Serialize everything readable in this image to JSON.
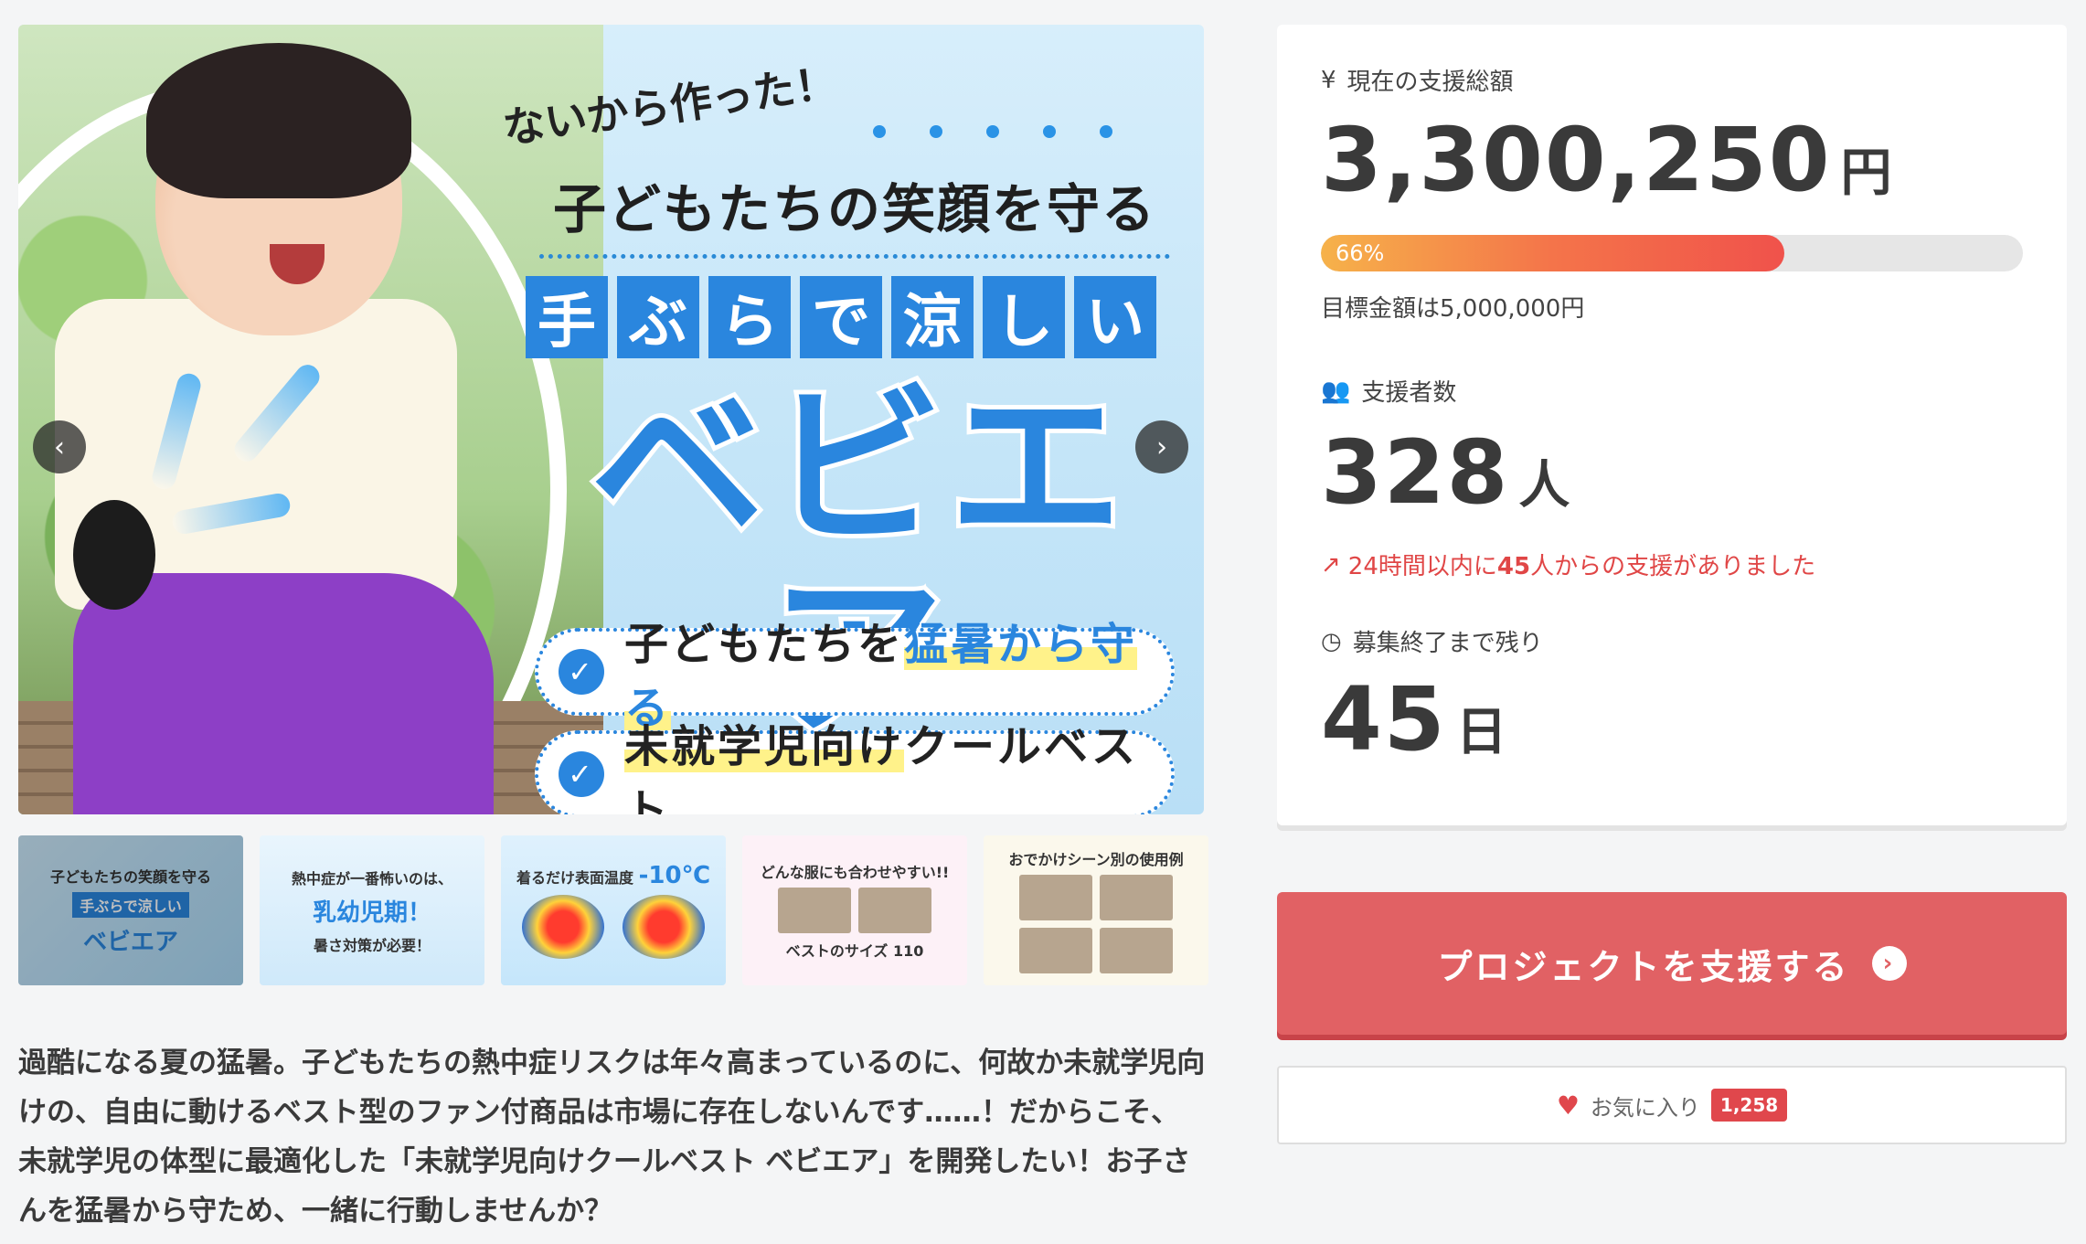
{
  "hero": {
    "tagline": "ないから作った！",
    "subtitle": "子どもたちの笑顔を守る",
    "tiles": [
      "手",
      "ぶ",
      "ら",
      "で",
      "涼",
      "し",
      "い"
    ],
    "title": "ベビエア",
    "pill1_prefix": "子どもたちを",
    "pill1_highlight": "猛暑から守る",
    "pill2_highlight": "未就学児向け",
    "pill2_suffix": "クールベスト",
    "prev_icon": "chevron-left-icon",
    "next_icon": "chevron-right-icon"
  },
  "thumbnails": [
    {
      "line1": "子どもたちの笑顔を守る",
      "line2": "手ぶらで涼しい",
      "line3": "ベビエア"
    },
    {
      "line1": "熱中症が一番怖いのは、",
      "line2": "乳幼児期！",
      "line3": "暑さ対策が必要！"
    },
    {
      "line1": "着るだけ表面温度",
      "line2": "-10℃"
    },
    {
      "line1": "どんな服にも合わせやすい!!",
      "line2": "ベストのサイズ 110"
    },
    {
      "line1": "おでかけシーン別の使用例"
    }
  ],
  "description": "過酷になる夏の猛暑。子どもたちの熱中症リスクは年々高まっているのに、何故か未就学児向けの、自由に動けるベスト型のファン付商品は市場に存在しないんです……！だからこそ、未就学児の体型に最適化した「未就学児向けクールベスト ベビエア」を開発したい！お子さんを猛暑から守ため、一緒に行動しませんか？",
  "stats": {
    "amount_label": "現在の支援総額",
    "amount_icon": "yen-icon",
    "amount_value": "3,300,250",
    "amount_unit": "円",
    "progress_percent": 66,
    "progress_label": "66%",
    "goal_text": "目標金額は5,000,000円",
    "backers_label": "支援者数",
    "backers_icon": "users-icon",
    "backers_value": "328",
    "backers_unit": "人",
    "recent_prefix": "24時間以内に",
    "recent_count": "45",
    "recent_suffix": "人からの支援がありました",
    "remaining_label": "募集終了まで残り",
    "remaining_icon": "clock-icon",
    "remaining_value": "45",
    "remaining_unit": "日"
  },
  "actions": {
    "support_label": "プロジェクトを支援する",
    "favorite_label": "お気に入り",
    "favorite_count": "1,258"
  },
  "colors": {
    "accent_blue": "#2a86de",
    "support_red": "#e16164",
    "alert_red": "#e04646"
  }
}
